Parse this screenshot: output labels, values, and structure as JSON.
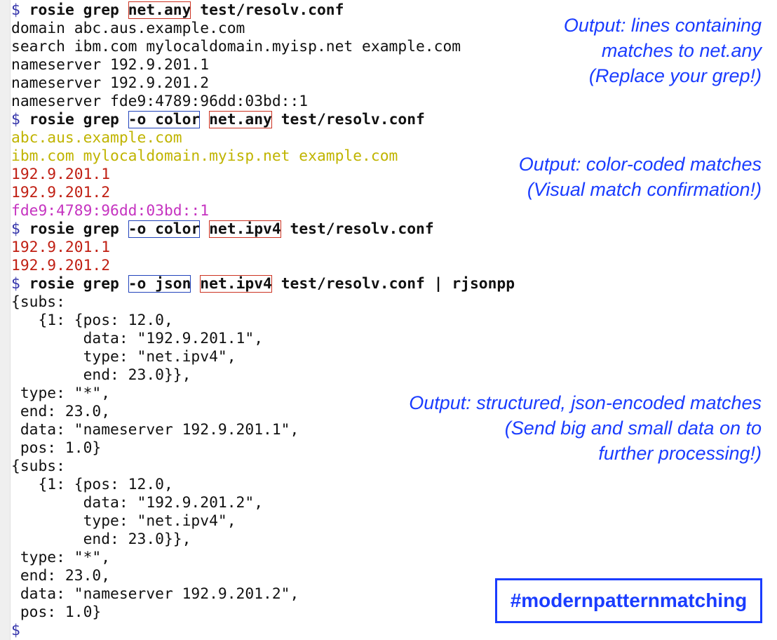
{
  "terminal": {
    "prompt": "$",
    "lines": [
      {
        "kind": "cmd",
        "segs": [
          {
            "t": "$",
            "s": "prompt"
          },
          {
            "t": " "
          },
          {
            "t": "rosie grep",
            "s": "bold"
          },
          {
            "t": " "
          },
          {
            "t": "net.any",
            "s": "bold box-red"
          },
          {
            "t": " "
          },
          {
            "t": "test/resolv.conf",
            "s": "bold"
          }
        ]
      },
      {
        "kind": "out",
        "segs": [
          {
            "t": "domain abc.aus.example.com"
          }
        ]
      },
      {
        "kind": "out",
        "segs": [
          {
            "t": "search ibm.com mylocaldomain.myisp.net example.com"
          }
        ]
      },
      {
        "kind": "out",
        "segs": [
          {
            "t": "nameserver 192.9.201.1"
          }
        ]
      },
      {
        "kind": "out",
        "segs": [
          {
            "t": "nameserver 192.9.201.2"
          }
        ]
      },
      {
        "kind": "out",
        "segs": [
          {
            "t": "nameserver fde9:4789:96dd:03bd::1"
          }
        ]
      },
      {
        "kind": "cmd",
        "segs": [
          {
            "t": "$",
            "s": "prompt"
          },
          {
            "t": " "
          },
          {
            "t": "rosie grep",
            "s": "bold"
          },
          {
            "t": " "
          },
          {
            "t": "-o color",
            "s": "bold box-blue"
          },
          {
            "t": " "
          },
          {
            "t": "net.any",
            "s": "bold box-red"
          },
          {
            "t": " "
          },
          {
            "t": "test/resolv.conf",
            "s": "bold"
          }
        ]
      },
      {
        "kind": "out",
        "segs": [
          {
            "t": "abc.aus.example.com",
            "s": "c-yellow"
          }
        ]
      },
      {
        "kind": "out",
        "segs": [
          {
            "t": "ibm.com mylocaldomain.myisp.net example.com",
            "s": "c-yellow"
          }
        ]
      },
      {
        "kind": "out",
        "segs": [
          {
            "t": "192.9.201.1",
            "s": "c-red"
          }
        ]
      },
      {
        "kind": "out",
        "segs": [
          {
            "t": "192.9.201.2",
            "s": "c-red"
          }
        ]
      },
      {
        "kind": "out",
        "segs": [
          {
            "t": "fde9:4789:96dd:03bd::1",
            "s": "c-magenta"
          }
        ]
      },
      {
        "kind": "cmd",
        "segs": [
          {
            "t": "$",
            "s": "prompt"
          },
          {
            "t": " "
          },
          {
            "t": "rosie grep",
            "s": "bold"
          },
          {
            "t": " "
          },
          {
            "t": "-o color",
            "s": "bold box-blue"
          },
          {
            "t": " "
          },
          {
            "t": "net.ipv4",
            "s": "bold box-red"
          },
          {
            "t": " "
          },
          {
            "t": "test/resolv.conf",
            "s": "bold"
          }
        ]
      },
      {
        "kind": "out",
        "segs": [
          {
            "t": "192.9.201.1",
            "s": "c-red"
          }
        ]
      },
      {
        "kind": "out",
        "segs": [
          {
            "t": "192.9.201.2",
            "s": "c-red"
          }
        ]
      },
      {
        "kind": "cmd",
        "segs": [
          {
            "t": "$",
            "s": "prompt"
          },
          {
            "t": " "
          },
          {
            "t": "rosie grep",
            "s": "bold"
          },
          {
            "t": " "
          },
          {
            "t": "-o json",
            "s": "bold box-blue"
          },
          {
            "t": " "
          },
          {
            "t": "net.ipv4",
            "s": "bold box-red"
          },
          {
            "t": " "
          },
          {
            "t": "test/resolv.conf | rjsonpp",
            "s": "bold"
          }
        ]
      },
      {
        "kind": "out",
        "segs": [
          {
            "t": "{subs:"
          }
        ]
      },
      {
        "kind": "out",
        "segs": [
          {
            "t": "   {1: {pos: 12.0,"
          }
        ]
      },
      {
        "kind": "out",
        "segs": [
          {
            "t": "        data: \"192.9.201.1\","
          }
        ]
      },
      {
        "kind": "out",
        "segs": [
          {
            "t": "        type: \"net.ipv4\","
          }
        ]
      },
      {
        "kind": "out",
        "segs": [
          {
            "t": "        end: 23.0}},"
          }
        ]
      },
      {
        "kind": "out",
        "segs": [
          {
            "t": " type: \"*\","
          }
        ]
      },
      {
        "kind": "out",
        "segs": [
          {
            "t": " end: 23.0,"
          }
        ]
      },
      {
        "kind": "out",
        "segs": [
          {
            "t": " data: \"nameserver 192.9.201.1\","
          }
        ]
      },
      {
        "kind": "out",
        "segs": [
          {
            "t": " pos: 1.0}"
          }
        ]
      },
      {
        "kind": "out",
        "segs": [
          {
            "t": "{subs:"
          }
        ]
      },
      {
        "kind": "out",
        "segs": [
          {
            "t": "   {1: {pos: 12.0,"
          }
        ]
      },
      {
        "kind": "out",
        "segs": [
          {
            "t": "        data: \"192.9.201.2\","
          }
        ]
      },
      {
        "kind": "out",
        "segs": [
          {
            "t": "        type: \"net.ipv4\","
          }
        ]
      },
      {
        "kind": "out",
        "segs": [
          {
            "t": "        end: 23.0}},"
          }
        ]
      },
      {
        "kind": "out",
        "segs": [
          {
            "t": " type: \"*\","
          }
        ]
      },
      {
        "kind": "out",
        "segs": [
          {
            "t": " end: 23.0,"
          }
        ]
      },
      {
        "kind": "out",
        "segs": [
          {
            "t": " data: \"nameserver 192.9.201.2\","
          }
        ]
      },
      {
        "kind": "out",
        "segs": [
          {
            "t": " pos: 1.0}"
          }
        ]
      },
      {
        "kind": "cmd",
        "segs": [
          {
            "t": "$",
            "s": "prompt"
          }
        ]
      }
    ]
  },
  "annotations": {
    "grep": [
      "Output: lines containing",
      "matches to net.any",
      "(Replace your grep!)"
    ],
    "color": [
      "Output: color-coded matches",
      "(Visual match confirmation!)"
    ],
    "json": [
      "Output: structured, json-encoded matches",
      "(Send big and small data on to",
      "further processing!)"
    ]
  },
  "hashtag": "#modernpatternmatching",
  "colors": {
    "annotation": "#1a3cff",
    "prompt": "#3333aa",
    "match_domain": "#c0b400",
    "match_ipv4": "#c01e12",
    "match_ipv6": "#c533c0",
    "pattern_box": "#cc3322",
    "option_box": "#2244bb"
  }
}
